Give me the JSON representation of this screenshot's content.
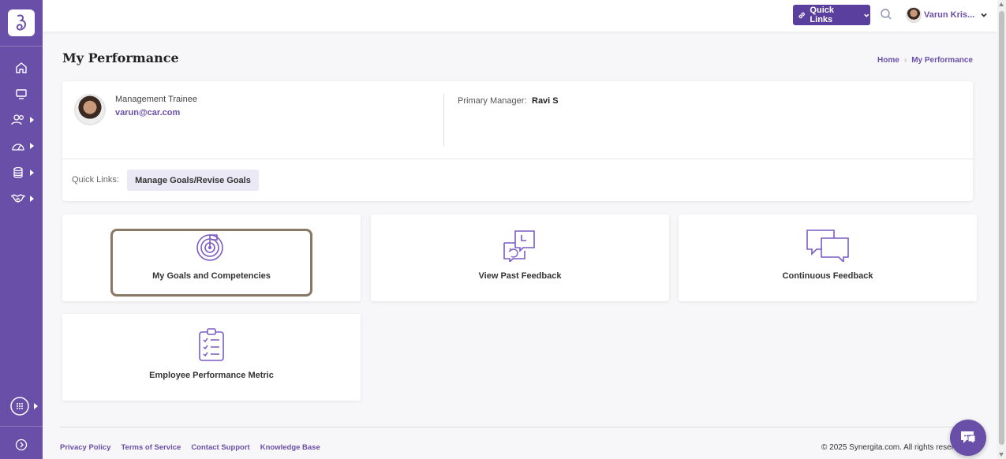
{
  "sidebar": {
    "items": [
      {
        "icon": "home-icon"
      },
      {
        "icon": "monitor-icon"
      },
      {
        "icon": "users-icon"
      },
      {
        "icon": "dashboard-icon"
      },
      {
        "icon": "database-icon"
      },
      {
        "icon": "handshake-icon"
      }
    ],
    "bottom_icons": [
      "apps-grid-icon",
      "expand-sidebar-icon"
    ]
  },
  "topbar": {
    "quick_links_label": "Quick Links",
    "user_name": "Varun Kris..."
  },
  "page": {
    "title": "My Performance",
    "breadcrumb": [
      "Home",
      "My Performance"
    ]
  },
  "profile": {
    "role": "Management Trainee",
    "email": "varun@car.com",
    "primary_manager_label": "Primary Manager:",
    "primary_manager": "Ravi S",
    "quick_links_label": "Quick Links:",
    "quick_link": "Manage Goals/Revise Goals"
  },
  "tiles": [
    {
      "label": "My Goals and Competencies",
      "icon": "target-icon"
    },
    {
      "label": "View Past Feedback",
      "icon": "feedback-history-icon"
    },
    {
      "label": "Continuous Feedback",
      "icon": "chat-bubbles-icon"
    },
    {
      "label": "Employee Performance Metric",
      "icon": "checklist-icon"
    }
  ],
  "footer": {
    "links": [
      "Privacy Policy",
      "Terms of Service",
      "Contact Support",
      "Knowledge Base"
    ],
    "copyright": "© 2025 Synergita.com. All rights reserved."
  },
  "colors": {
    "sidebar": "#6a4fa8",
    "accent": "#5b3f9e",
    "icon_purple": "#7b5cc4"
  }
}
